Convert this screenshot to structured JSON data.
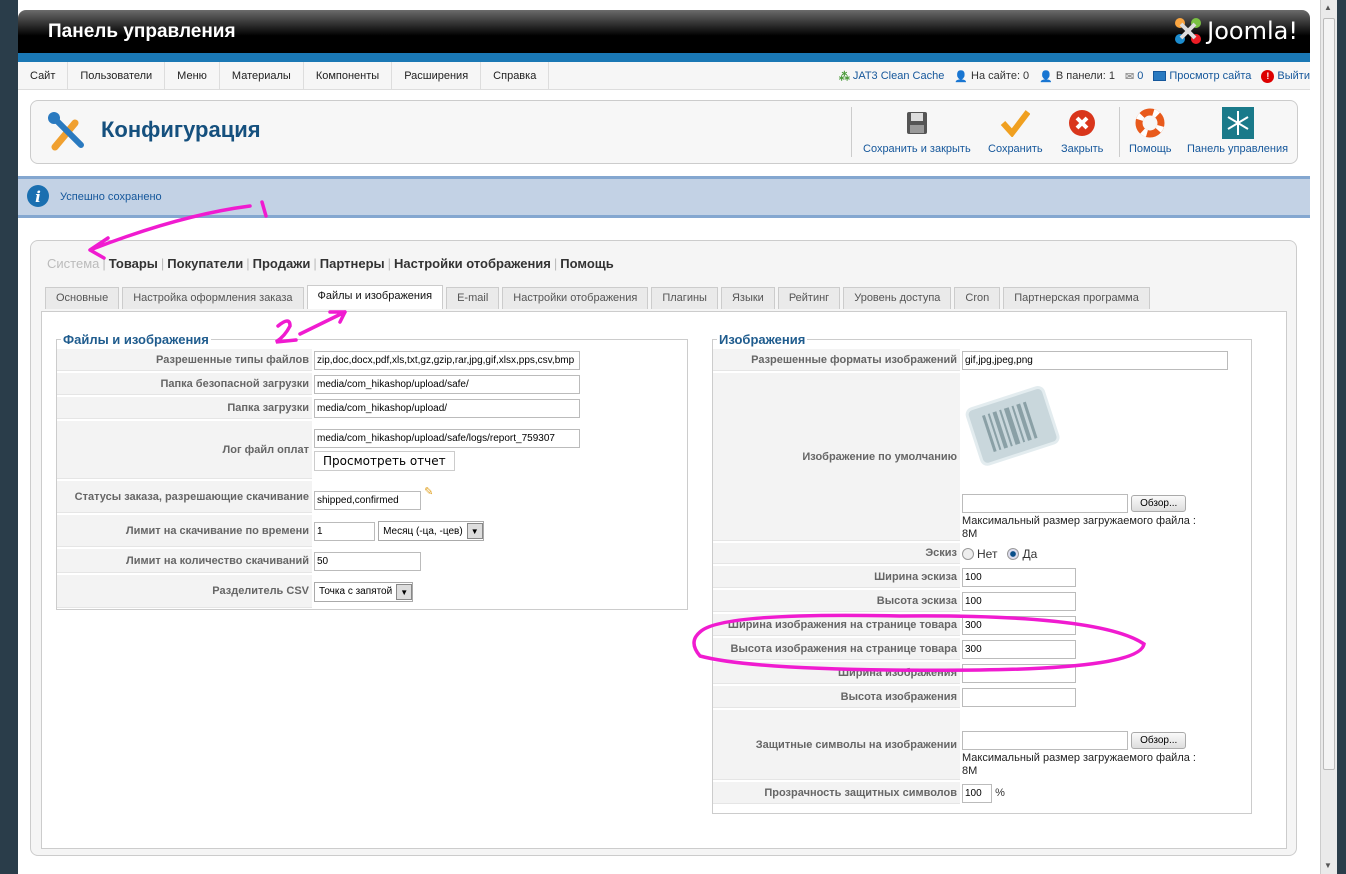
{
  "header": {
    "title": "Панель управления",
    "logo": "Joomla!"
  },
  "menu": [
    "Сайт",
    "Пользователи",
    "Меню",
    "Материалы",
    "Компоненты",
    "Расширения",
    "Справка"
  ],
  "status": {
    "cache": "JAT3 Clean Cache",
    "on_site": "На сайте: 0",
    "in_panel": "В панели: 1",
    "messages": "0",
    "view_site": "Просмотр сайта",
    "logout": "Выйти"
  },
  "toolbar": {
    "title": "Конфигурация",
    "save_close": "Сохранить и закрыть",
    "save": "Сохранить",
    "close": "Закрыть",
    "help": "Помощь",
    "panel": "Панель управления"
  },
  "message": "Успешно сохранено",
  "topnav": [
    "Система",
    "Товары",
    "Покупатели",
    "Продажи",
    "Партнеры",
    "Настройки отображения",
    "Помощь"
  ],
  "tabs": [
    "Основные",
    "Настройка оформления заказа",
    "Файлы и изображения",
    "E-mail",
    "Настройки отображения",
    "Плагины",
    "Языки",
    "Рейтинг",
    "Уровень доступа",
    "Cron",
    "Партнерская программа"
  ],
  "files": {
    "legend": "Файлы и изображения",
    "allowed_types_label": "Разрешенные типы файлов",
    "allowed_types": "zip,doc,docx,pdf,xls,txt,gz,gzip,rar,jpg,gif,xlsx,pps,csv,bmp",
    "safe_folder_label": "Папка безопасной загрузки",
    "safe_folder": "media/com_hikashop/upload/safe/",
    "upload_folder_label": "Папка загрузки",
    "upload_folder": "media/com_hikashop/upload/",
    "log_label": "Лог файл оплат",
    "log": "media/com_hikashop/upload/safe/logs/report_759307",
    "view_report": "Просмотреть отчет",
    "statuses_label": "Статусы заказа, разрешающие скачивание",
    "statuses": "shipped,confirmed",
    "time_limit_label": "Лимит на скачивание по времени",
    "time_limit": "1",
    "time_unit": "Месяц (-ца, -цев)",
    "count_limit_label": "Лимит на количество скачиваний",
    "count_limit": "50",
    "csv_label": "Разделитель CSV",
    "csv": "Точка с запятой"
  },
  "images": {
    "legend": "Изображения",
    "formats_label": "Разрешенные форматы изображений",
    "formats": "gif,jpg,jpeg,png",
    "default_label": "Изображение по умолчанию",
    "browse": "Обзор...",
    "max_size": "Максимальный размер загружаемого файла :",
    "max_size_val": "8M",
    "thumb_label": "Эскиз",
    "no": "Нет",
    "yes": "Да",
    "thumb_w_label": "Ширина эскиза",
    "thumb_w": "100",
    "thumb_h_label": "Высота эскиза",
    "thumb_h": "100",
    "prod_w_label": "Ширина изображения на странице товара",
    "prod_w": "300",
    "prod_h_label": "Высота изображения на странице товара",
    "prod_h": "300",
    "img_w_label": "Ширина изображения",
    "img_h_label": "Высота изображения",
    "watermark_label": "Защитные символы на изображении",
    "opacity_label": "Прозрачность защитных символов",
    "opacity": "100",
    "pct": "%"
  }
}
